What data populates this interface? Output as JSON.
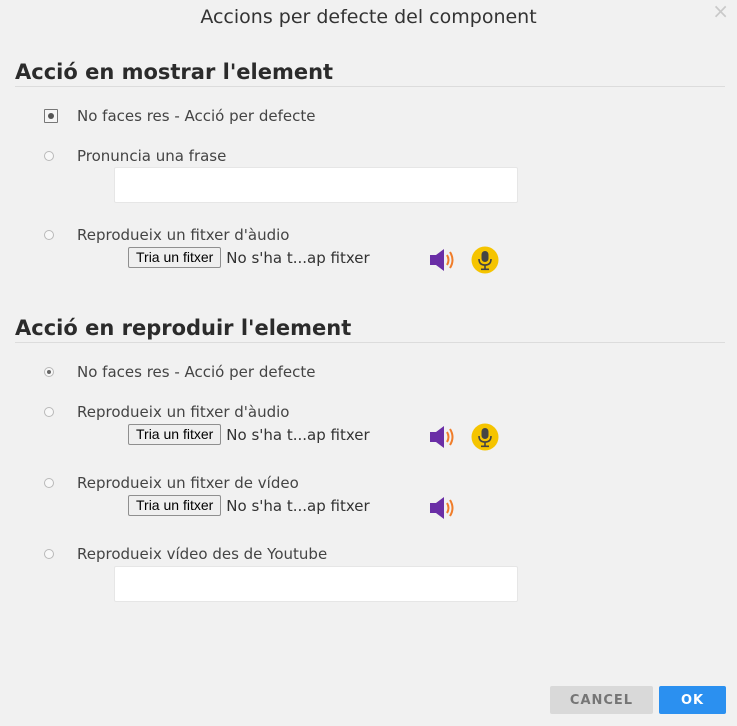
{
  "dialog": {
    "title": "Accions per defecte del component",
    "close": "×"
  },
  "show_section": {
    "title": "Acció en mostrar l'element",
    "options": [
      {
        "label": "No faces res - Acció per defecte",
        "checked": true
      },
      {
        "label": "Pronuncia una frase",
        "checked": false
      },
      {
        "label": "Reprodueix un fitxer d'àudio",
        "checked": false
      }
    ],
    "audio_file": {
      "button": "Tria un fitxer",
      "status": "No s'ha t...ap fitxer"
    }
  },
  "play_section": {
    "title": "Acció en reproduir l'element",
    "options": [
      {
        "label": "No faces res - Acció per defecte",
        "checked": true
      },
      {
        "label": "Reprodueix un fitxer d'àudio",
        "checked": false
      },
      {
        "label": "Reprodueix un fitxer de vídeo",
        "checked": false
      },
      {
        "label": "Reprodueix vídeo des de Youtube",
        "checked": false
      }
    ],
    "audio_file": {
      "button": "Tria un fitxer",
      "status": "No s'ha t...ap fitxer"
    },
    "video_file": {
      "button": "Tria un fitxer",
      "status": "No s'ha t...ap fitxer"
    }
  },
  "footer": {
    "cancel": "CANCEL",
    "ok": "OK"
  },
  "colors": {
    "accent": "#2b90f0",
    "speaker": "#6a2ea6",
    "mic": "#f5c400"
  },
  "icons": [
    "speaker-icon",
    "microphone-icon",
    "close-icon"
  ]
}
